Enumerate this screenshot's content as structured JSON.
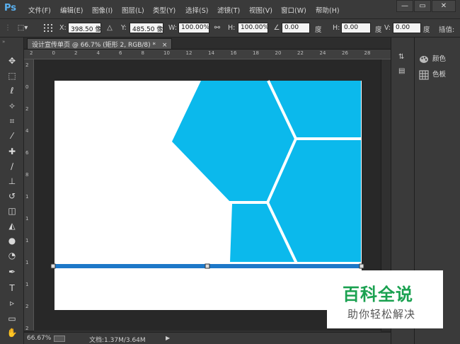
{
  "app": {
    "logo": "Ps"
  },
  "menu": [
    "文件(F)",
    "编辑(E)",
    "图像(I)",
    "图层(L)",
    "类型(Y)",
    "选择(S)",
    "滤镜(T)",
    "视图(V)",
    "窗口(W)",
    "帮助(H)"
  ],
  "window_controls": {
    "minimize": "—",
    "restore": "▭",
    "close": "✕"
  },
  "options": {
    "x_label": "X:",
    "x_value": "398.50 像",
    "y_label": "Y:",
    "y_value": "485.50 像",
    "w_label": "W:",
    "w_value": "100.00%",
    "h_label": "H:",
    "h_value": "100.00%",
    "rot_value": "0.00",
    "rot_unit": "度",
    "hskew_label": "H:",
    "hskew_value": "0.00",
    "hskew_unit": "度",
    "vskew_label": "V:",
    "vskew_value": "0.00",
    "vskew_unit": "度",
    "interp_label": "插值:"
  },
  "document": {
    "tab_title": "设计宣传单页 @ 66.7% (矩形 2, RGB/8) *",
    "tab_close": "×"
  },
  "ruler": {
    "top": [
      "2",
      "0",
      "2",
      "4",
      "6",
      "8",
      "10",
      "12",
      "14",
      "16",
      "18",
      "20",
      "22",
      "24",
      "26",
      "28"
    ],
    "left": [
      "2",
      "0",
      "2",
      "4",
      "6",
      "8",
      "1",
      "1",
      "1",
      "1",
      "1",
      "2",
      "2"
    ]
  },
  "status": {
    "zoom": "66.67%",
    "doc_info": "文档:1.37M/3.64M"
  },
  "panels": [
    {
      "label": "颜色",
      "icon": "palette-icon"
    },
    {
      "label": "色板",
      "icon": "swatches-grid-icon"
    }
  ],
  "canvas": {
    "hex_color": "#0bb9ec",
    "bg": "#ffffff",
    "selected_rect_color": "#1d78c8",
    "stripe": "#ffffff"
  },
  "watermark": {
    "title": "百科全说",
    "subtitle": "助你轻松解决"
  }
}
